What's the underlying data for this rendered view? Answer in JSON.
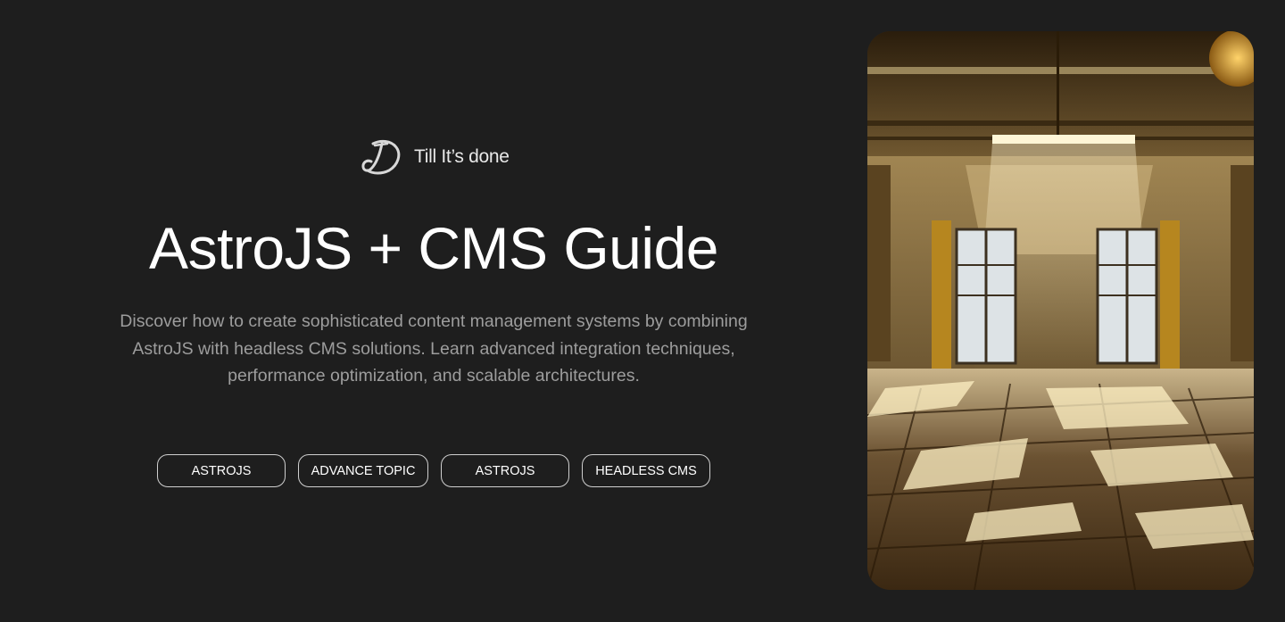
{
  "brand": {
    "logo_icon": "brand-monogram-icon",
    "name": "Till It’s done"
  },
  "hero": {
    "title": "AstroJS + CMS Guide",
    "description": "Discover how to create sophisticated content management systems by combining AstroJS with headless CMS solutions. Learn advanced integration techniques, performance optimization, and scalable architectures."
  },
  "tags": [
    {
      "label": "ASTROJS"
    },
    {
      "label": "ADVANCE TOPIC"
    },
    {
      "label": "ASTROJS"
    },
    {
      "label": "HEADLESS CMS"
    }
  ],
  "image": {
    "subject": "sunlit empty ballroom with polished wooden floor"
  },
  "colors": {
    "background": "#1e1e1e",
    "text": "#ffffff",
    "muted_text": "#9d9d9d",
    "tag_border": "#cfcfcf"
  }
}
